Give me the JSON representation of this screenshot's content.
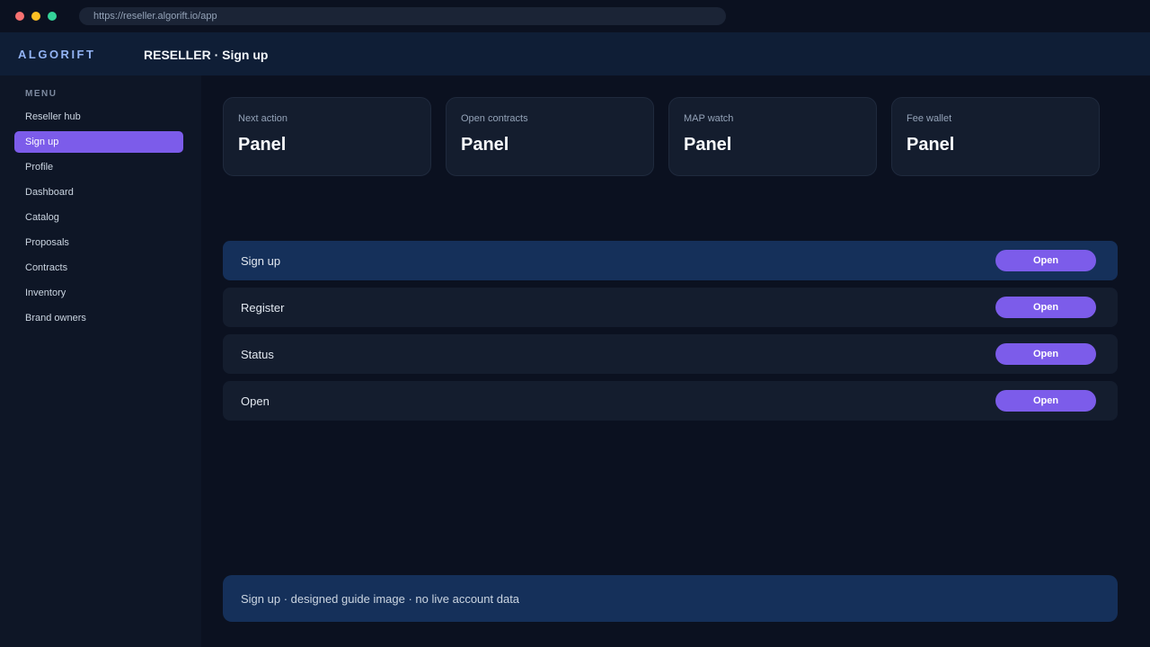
{
  "browser": {
    "url": "https://reseller.algorift.io/app"
  },
  "header": {
    "brand": "ALGORIFT",
    "title": "RESELLER · Sign up"
  },
  "sidebar": {
    "heading": "MENU",
    "items": [
      {
        "label": "Reseller hub"
      },
      {
        "label": "Sign up",
        "active": true
      },
      {
        "label": "Profile"
      },
      {
        "label": "Dashboard"
      },
      {
        "label": "Catalog"
      },
      {
        "label": "Proposals"
      },
      {
        "label": "Contracts"
      },
      {
        "label": "Inventory"
      },
      {
        "label": "Brand owners"
      }
    ]
  },
  "cards": [
    {
      "label": "Next action",
      "value": "Panel"
    },
    {
      "label": "Open contracts",
      "value": "Panel"
    },
    {
      "label": "MAP watch",
      "value": "Panel"
    },
    {
      "label": "Fee wallet",
      "value": "Panel"
    }
  ],
  "rows": [
    {
      "label": "Sign up",
      "button": "Open",
      "active": true
    },
    {
      "label": "Register",
      "button": "Open"
    },
    {
      "label": "Status",
      "button": "Open"
    },
    {
      "label": "Open",
      "button": "Open"
    }
  ],
  "footer": {
    "text": "Sign up · designed guide image · no live account data"
  },
  "colors": {
    "accent": "#7c5cea",
    "background": "#0b1120",
    "panel": "#141d2e",
    "highlight": "#15305a",
    "brand": "#93b4f5"
  }
}
